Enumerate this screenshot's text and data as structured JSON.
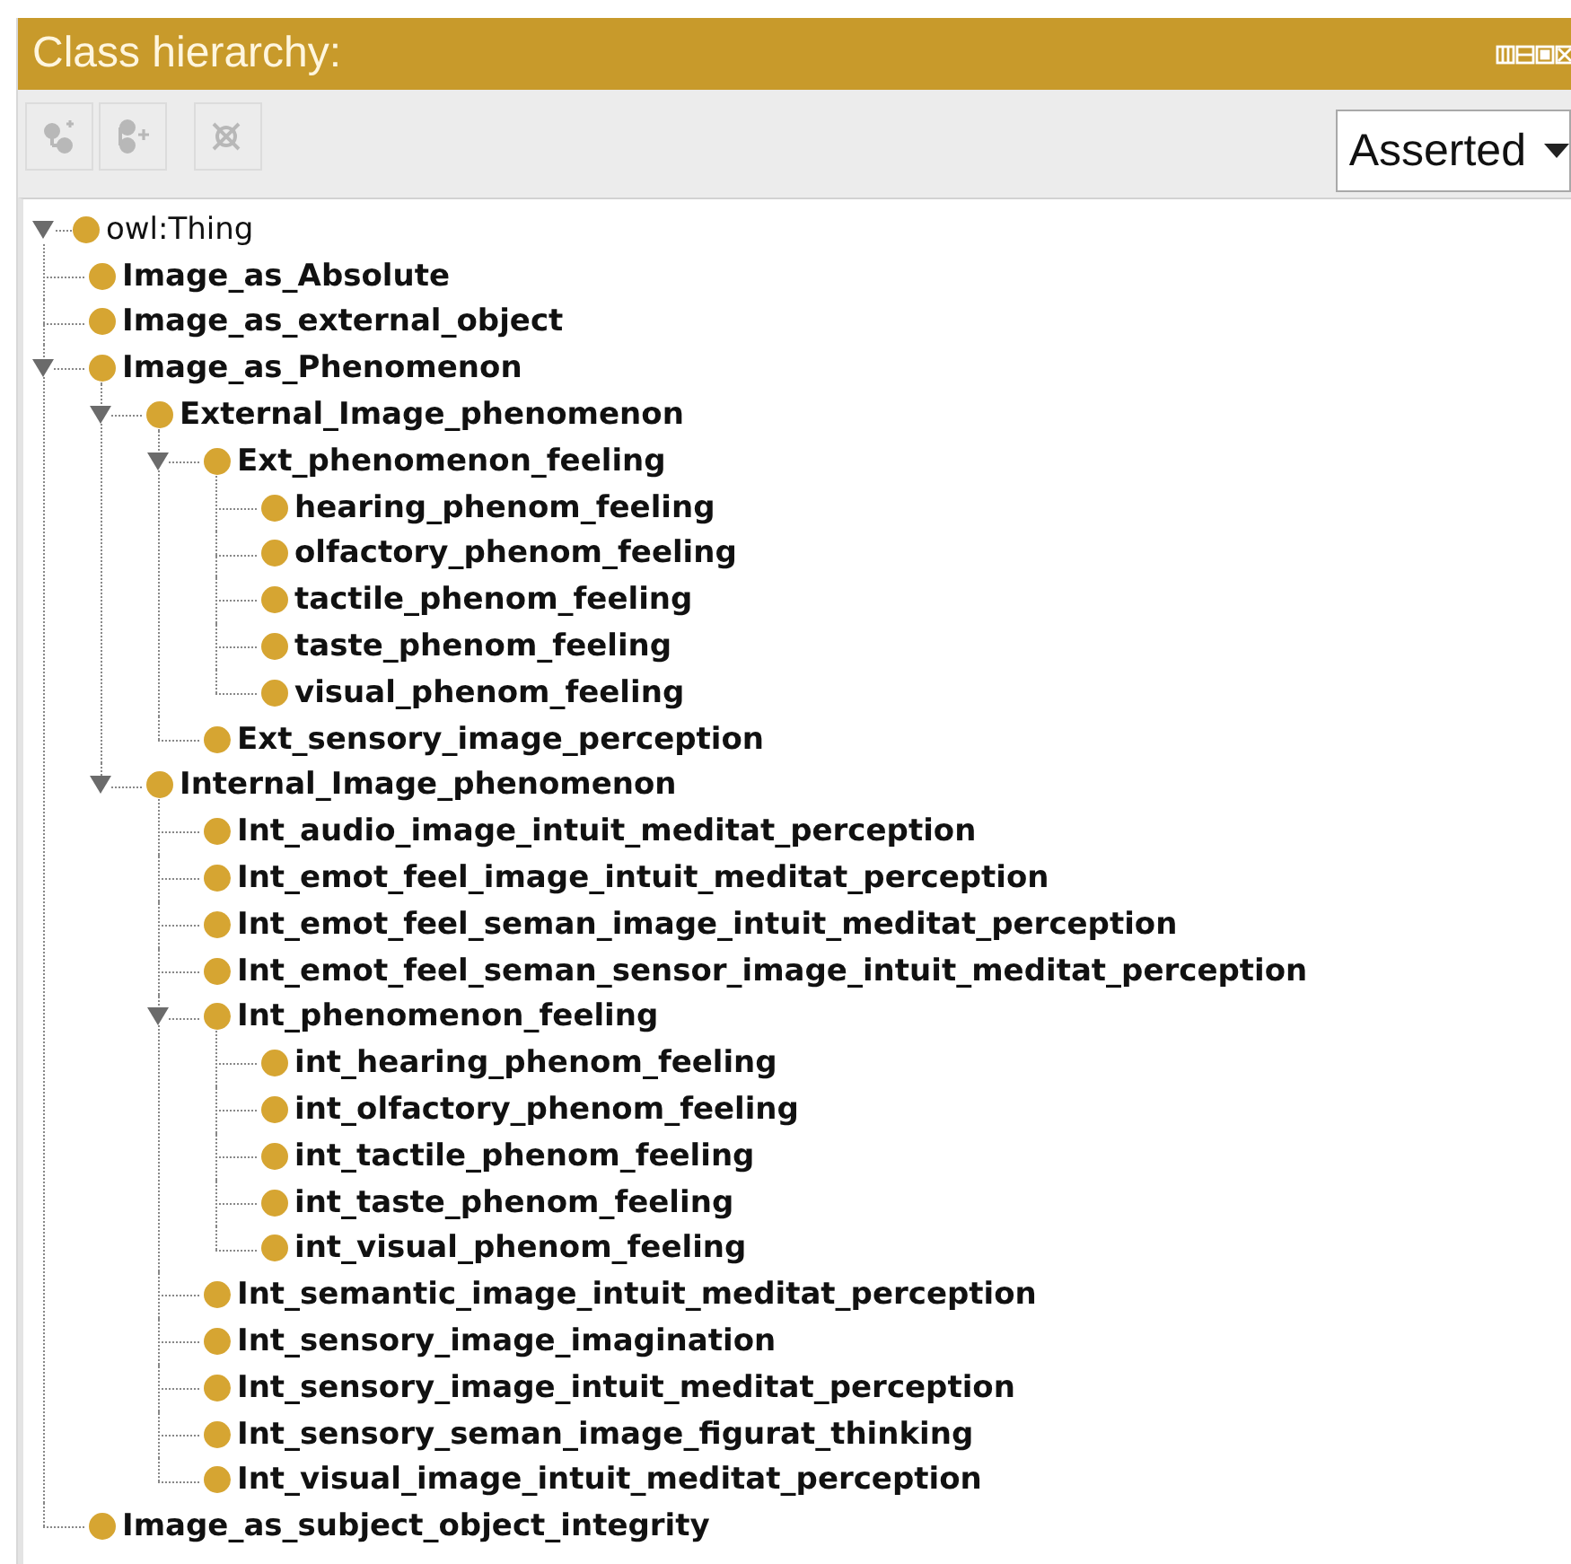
{
  "panel": {
    "title": "Class hierarchy:"
  },
  "toolbar": {
    "buttons": [
      {
        "kind": "add_subclass",
        "disabled": true
      },
      {
        "kind": "add_sibling",
        "disabled": true
      },
      {
        "kind": "delete",
        "disabled": true
      }
    ],
    "view_selector": {
      "value": "Asserted"
    }
  },
  "tree": [
    {
      "label": "owl:Thing",
      "bold": false,
      "expanded": true,
      "children": [
        {
          "label": "Image_as_Absolute",
          "bold": true
        },
        {
          "label": "Image_as_external_object",
          "bold": true
        },
        {
          "label": "Image_as_Phenomenon",
          "bold": true,
          "expanded": true,
          "children": [
            {
              "label": "External_Image_phenomenon",
              "bold": true,
              "expanded": true,
              "children": [
                {
                  "label": "Ext_phenomenon_feeling",
                  "bold": true,
                  "expanded": true,
                  "children": [
                    {
                      "label": "hearing_phenom_feeling",
                      "bold": true
                    },
                    {
                      "label": "olfactory_phenom_feeling",
                      "bold": true
                    },
                    {
                      "label": "tactile_phenom_feeling",
                      "bold": true
                    },
                    {
                      "label": "taste_phenom_feeling",
                      "bold": true
                    },
                    {
                      "label": "visual_phenom_feeling",
                      "bold": true
                    }
                  ]
                },
                {
                  "label": "Ext_sensory_image_perception",
                  "bold": true
                }
              ]
            },
            {
              "label": "Internal_Image_phenomenon",
              "bold": true,
              "expanded": true,
              "children": [
                {
                  "label": "Int_audio_image_intuit_meditat_perception",
                  "bold": true
                },
                {
                  "label": "Int_emot_feel_image_intuit_meditat_perception",
                  "bold": true
                },
                {
                  "label": "Int_emot_feel_seman_image_intuit_meditat_perception",
                  "bold": true
                },
                {
                  "label": "Int_emot_feel_seman_sensor_image_intuit_meditat_perception",
                  "bold": true
                },
                {
                  "label": "Int_phenomenon_feeling",
                  "bold": true,
                  "expanded": true,
                  "children": [
                    {
                      "label": "int_hearing_phenom_feeling",
                      "bold": true
                    },
                    {
                      "label": "int_olfactory_phenom_feeling",
                      "bold": true
                    },
                    {
                      "label": "int_tactile_phenom_feeling",
                      "bold": true
                    },
                    {
                      "label": "int_taste_phenom_feeling",
                      "bold": true
                    },
                    {
                      "label": "int_visual_phenom_feeling",
                      "bold": true
                    }
                  ]
                },
                {
                  "label": "Int_semantic_image_intuit_meditat_perception",
                  "bold": true
                },
                {
                  "label": "Int_sensory_image_imagination",
                  "bold": true
                },
                {
                  "label": "Int_sensory_image_intuit_meditat_perception",
                  "bold": true
                },
                {
                  "label": "Int_sensory_seman_image_figurat_thinking",
                  "bold": true
                },
                {
                  "label": "Int_visual_image_intuit_meditat_perception",
                  "bold": true
                }
              ]
            }
          ]
        },
        {
          "label": "Image_as_subject_object_integrity",
          "bold": true
        }
      ]
    }
  ]
}
